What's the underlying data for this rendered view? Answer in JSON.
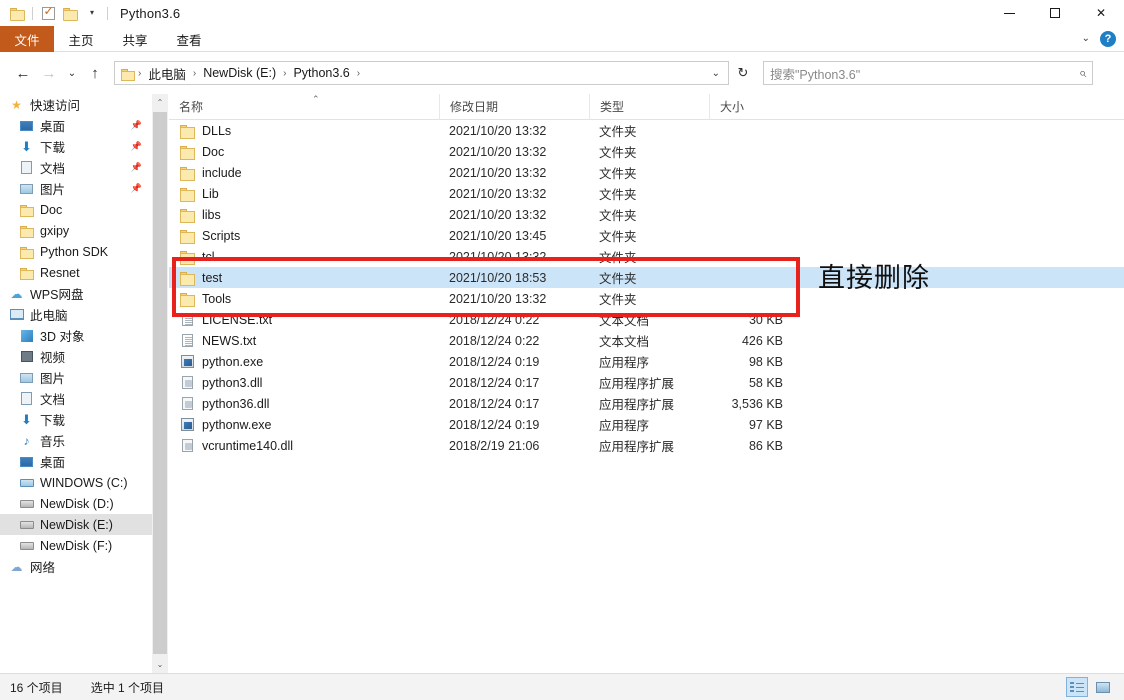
{
  "window": {
    "title": "Python3.6",
    "quick_access": [
      "folder-icon",
      "checkbox-icon",
      "folder-icon"
    ],
    "controls": {
      "minimize": "minimize-icon",
      "maximize": "maximize-icon",
      "close": "✕"
    }
  },
  "ribbon": {
    "tabs": [
      {
        "label": "文件",
        "active_file_tab": true
      },
      {
        "label": "主页",
        "active_file_tab": false
      },
      {
        "label": "共享",
        "active_file_tab": false
      },
      {
        "label": "查看",
        "active_file_tab": false
      }
    ],
    "collapse_caret": "⌄",
    "help_label": "?"
  },
  "addressbar": {
    "back": "←",
    "forward": "→",
    "recent_caret": "⌄",
    "up": "↑",
    "breadcrumbs": [
      "此电脑",
      "NewDisk (E:)",
      "Python3.6"
    ],
    "crumb_separator": "›",
    "dropdown_caret": "⌄",
    "refresh": "↻",
    "search_placeholder": "搜索\"Python3.6\"",
    "search_value": "搜索\"Python3.6\""
  },
  "sidebar": {
    "items": [
      {
        "label": "快速访问",
        "icon": "star-icon",
        "level": 0,
        "pinned": false,
        "selected": false
      },
      {
        "label": "桌面",
        "icon": "desktop-icon",
        "level": 1,
        "pinned": true,
        "selected": false
      },
      {
        "label": "下载",
        "icon": "download-icon",
        "level": 1,
        "pinned": true,
        "selected": false
      },
      {
        "label": "文档",
        "icon": "document-icon",
        "level": 1,
        "pinned": true,
        "selected": false
      },
      {
        "label": "图片",
        "icon": "pictures-icon",
        "level": 1,
        "pinned": true,
        "selected": false
      },
      {
        "label": "Doc",
        "icon": "folder-icon",
        "level": 1,
        "pinned": false,
        "selected": false
      },
      {
        "label": "gxipy",
        "icon": "folder-icon",
        "level": 1,
        "pinned": false,
        "selected": false
      },
      {
        "label": "Python SDK",
        "icon": "folder-icon",
        "level": 1,
        "pinned": false,
        "selected": false
      },
      {
        "label": "Resnet",
        "icon": "folder-icon",
        "level": 1,
        "pinned": false,
        "selected": false
      },
      {
        "label": "WPS网盘",
        "icon": "cloud-icon",
        "level": 0,
        "pinned": false,
        "selected": false
      },
      {
        "label": "此电脑",
        "icon": "pc-icon",
        "level": 0,
        "pinned": false,
        "selected": false
      },
      {
        "label": "3D 对象",
        "icon": "3d-objects-icon",
        "level": 1,
        "pinned": false,
        "selected": false
      },
      {
        "label": "视频",
        "icon": "video-icon",
        "level": 1,
        "pinned": false,
        "selected": false
      },
      {
        "label": "图片",
        "icon": "pictures-icon",
        "level": 1,
        "pinned": false,
        "selected": false
      },
      {
        "label": "文档",
        "icon": "document-icon",
        "level": 1,
        "pinned": false,
        "selected": false
      },
      {
        "label": "下载",
        "icon": "download-icon",
        "level": 1,
        "pinned": false,
        "selected": false
      },
      {
        "label": "音乐",
        "icon": "music-icon",
        "level": 1,
        "pinned": false,
        "selected": false
      },
      {
        "label": "桌面",
        "icon": "desktop-icon",
        "level": 1,
        "pinned": false,
        "selected": false
      },
      {
        "label": "WINDOWS (C:)",
        "icon": "windows-drive-icon",
        "level": 1,
        "pinned": false,
        "selected": false
      },
      {
        "label": "NewDisk (D:)",
        "icon": "drive-icon",
        "level": 1,
        "pinned": false,
        "selected": false
      },
      {
        "label": "NewDisk (E:)",
        "icon": "drive-icon",
        "level": 1,
        "pinned": false,
        "selected": true
      },
      {
        "label": "NewDisk (F:)",
        "icon": "drive-icon",
        "level": 1,
        "pinned": false,
        "selected": false
      },
      {
        "label": "网络",
        "icon": "network-icon",
        "level": 0,
        "pinned": false,
        "selected": false
      }
    ],
    "scroll_up": "⌃",
    "scroll_down": "⌄"
  },
  "filelist": {
    "columns": [
      {
        "key": "name",
        "label": "名称"
      },
      {
        "key": "date",
        "label": "修改日期"
      },
      {
        "key": "type",
        "label": "类型"
      },
      {
        "key": "size",
        "label": "大小"
      }
    ],
    "sort_indicator": "⌃",
    "rows": [
      {
        "name": "DLLs",
        "date": "2021/10/20 13:32",
        "type": "文件夹",
        "size": "",
        "icon": "folder-icon",
        "selected": false
      },
      {
        "name": "Doc",
        "date": "2021/10/20 13:32",
        "type": "文件夹",
        "size": "",
        "icon": "folder-icon",
        "selected": false
      },
      {
        "name": "include",
        "date": "2021/10/20 13:32",
        "type": "文件夹",
        "size": "",
        "icon": "folder-icon",
        "selected": false
      },
      {
        "name": "Lib",
        "date": "2021/10/20 13:32",
        "type": "文件夹",
        "size": "",
        "icon": "folder-icon",
        "selected": false
      },
      {
        "name": "libs",
        "date": "2021/10/20 13:32",
        "type": "文件夹",
        "size": "",
        "icon": "folder-icon",
        "selected": false
      },
      {
        "name": "Scripts",
        "date": "2021/10/20 13:45",
        "type": "文件夹",
        "size": "",
        "icon": "folder-icon",
        "selected": false
      },
      {
        "name": "tcl",
        "date": "2021/10/20 13:32",
        "type": "文件夹",
        "size": "",
        "icon": "folder-icon",
        "selected": false
      },
      {
        "name": "test",
        "date": "2021/10/20 18:53",
        "type": "文件夹",
        "size": "",
        "icon": "folder-icon",
        "selected": true
      },
      {
        "name": "Tools",
        "date": "2021/10/20 13:32",
        "type": "文件夹",
        "size": "",
        "icon": "folder-icon",
        "selected": false
      },
      {
        "name": "LICENSE.txt",
        "date": "2018/12/24 0:22",
        "type": "文本文档",
        "size": "30 KB",
        "icon": "text-file-icon",
        "selected": false
      },
      {
        "name": "NEWS.txt",
        "date": "2018/12/24 0:22",
        "type": "文本文档",
        "size": "426 KB",
        "icon": "text-file-icon",
        "selected": false
      },
      {
        "name": "python.exe",
        "date": "2018/12/24 0:19",
        "type": "应用程序",
        "size": "98 KB",
        "icon": "executable-icon",
        "selected": false
      },
      {
        "name": "python3.dll",
        "date": "2018/12/24 0:17",
        "type": "应用程序扩展",
        "size": "58 KB",
        "icon": "dll-icon",
        "selected": false
      },
      {
        "name": "python36.dll",
        "date": "2018/12/24 0:17",
        "type": "应用程序扩展",
        "size": "3,536 KB",
        "icon": "dll-icon",
        "selected": false
      },
      {
        "name": "pythonw.exe",
        "date": "2018/12/24 0:19",
        "type": "应用程序",
        "size": "97 KB",
        "icon": "executable-icon",
        "selected": false
      },
      {
        "name": "vcruntime140.dll",
        "date": "2018/2/19 21:06",
        "type": "应用程序扩展",
        "size": "86 KB",
        "icon": "dll-icon",
        "selected": false
      }
    ]
  },
  "annotations": {
    "box_color": "#e8211d",
    "text": "直接删除"
  },
  "statusbar": {
    "item_count": "16 个项目",
    "selection_count": "选中 1 个项目",
    "views": [
      {
        "name": "details-view",
        "active": true
      },
      {
        "name": "large-icons-view",
        "active": false
      }
    ]
  }
}
